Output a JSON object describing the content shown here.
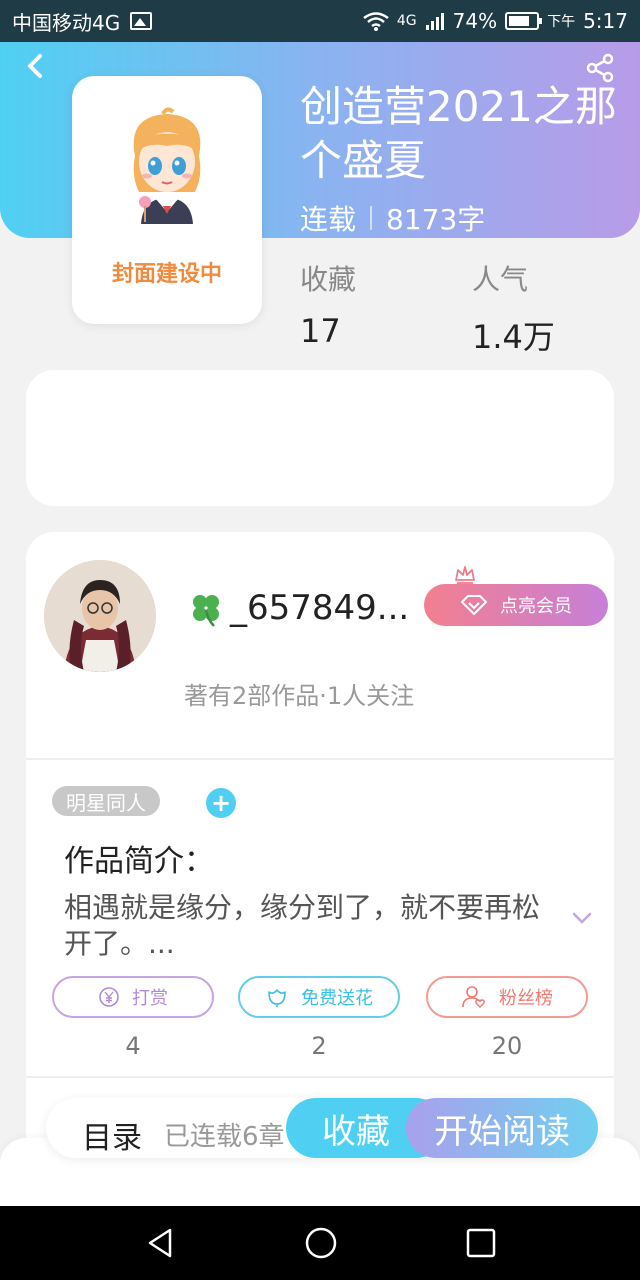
{
  "status": {
    "carrier": "中国移动4G",
    "network": "4G",
    "battery": "74%",
    "time_prefix": "下午",
    "time": "5:17"
  },
  "book": {
    "cover_text": "封面建设中",
    "title": "创造营2021之那个盛夏",
    "status": "连载",
    "word_count": "8173字",
    "stats": [
      {
        "label": "收藏",
        "value": "17"
      },
      {
        "label": "人气",
        "value": "1.4万"
      }
    ]
  },
  "author": {
    "name": "_657849...",
    "vip_label": "点亮会员",
    "subtitle": "著有2部作品·1人关注"
  },
  "intro": {
    "tag": "明星同人",
    "title": "作品简介：",
    "text": "相遇就是缘分，缘分到了，就不要再松开了。..."
  },
  "actions": [
    {
      "label": "打赏",
      "count": "4",
      "icon": "yen-icon"
    },
    {
      "label": "免费送花",
      "count": "2",
      "icon": "flower-icon"
    },
    {
      "label": "粉丝榜",
      "count": "20",
      "icon": "fans-icon"
    }
  ],
  "bottom_bar": {
    "toc_label": "目录",
    "toc_status": "已连载6章",
    "favorite_label": "收藏",
    "read_label": "开始阅读"
  },
  "colors": {
    "accent_blue": "#4fd0f2",
    "accent_purple": "#b89be8",
    "cover_text": "#f08a3c"
  }
}
